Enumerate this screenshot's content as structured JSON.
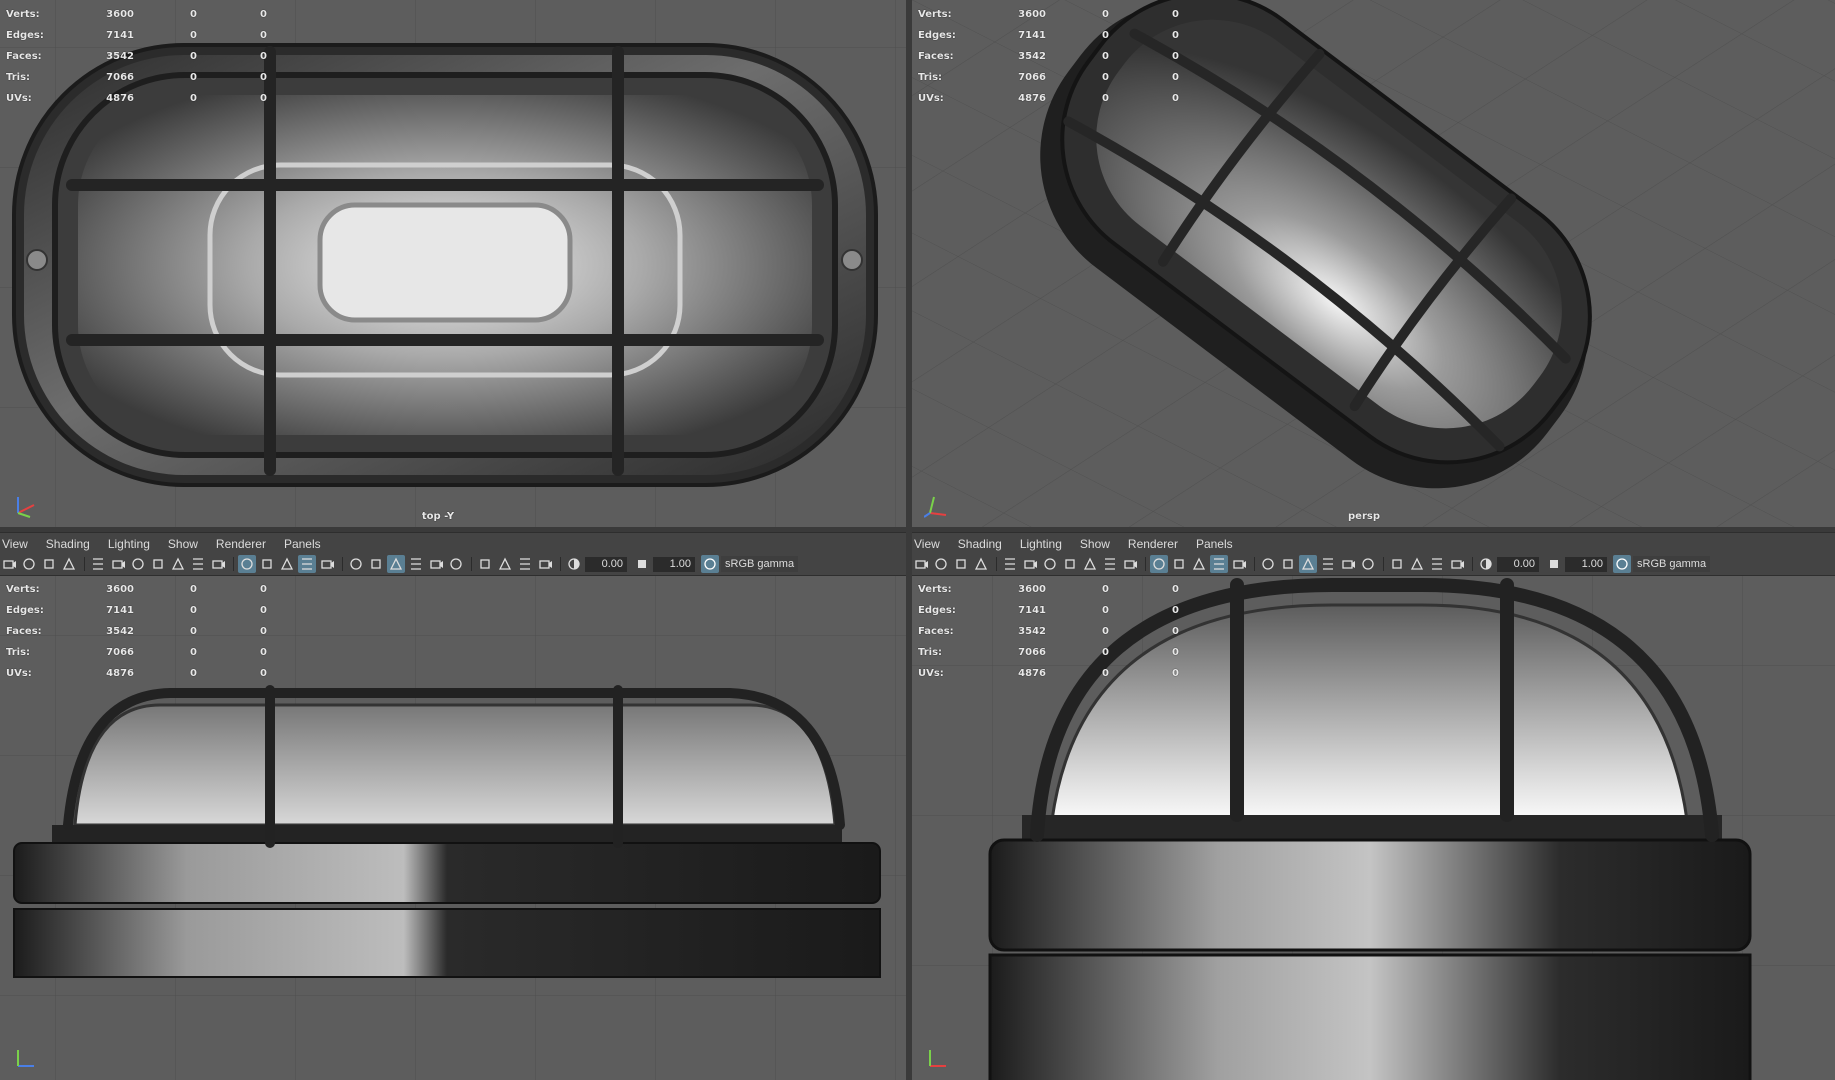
{
  "stats": [
    {
      "label": "Verts:",
      "v1": "3600",
      "v2": "0",
      "v3": "0"
    },
    {
      "label": "Edges:",
      "v1": "7141",
      "v2": "0",
      "v3": "0"
    },
    {
      "label": "Faces:",
      "v1": "3542",
      "v2": "0",
      "v3": "0"
    },
    {
      "label": "Tris:",
      "v1": "7066",
      "v2": "0",
      "v3": "0"
    },
    {
      "label": "UVs:",
      "v1": "4876",
      "v2": "0",
      "v3": "0"
    }
  ],
  "viewports": {
    "top_left": {
      "camera": "top -Y"
    },
    "top_right": {
      "camera": "persp"
    }
  },
  "panel": {
    "menus": [
      "View",
      "Shading",
      "Lighting",
      "Show",
      "Renderer",
      "Panels"
    ],
    "exposure": "0.00",
    "gamma": "1.00",
    "colorspace": "sRGB gamma",
    "icons": [
      "camera-icon",
      "camera-attr-icon",
      "bookmark-icon",
      "image-plane-icon",
      "grid-toggle-icon",
      "film-gate-icon",
      "resolution-gate-icon",
      "gate-mask-icon",
      "field-chart-icon",
      "safe-action-icon",
      "safe-title-icon",
      "wireframe-icon",
      "smooth-shade-icon",
      "default-material-icon",
      "textured-icon",
      "xray-icon",
      "use-lights-icon",
      "shadows-icon",
      "ambient-occlusion-icon",
      "motion-blur-icon",
      "anti-alias-icon",
      "depth-of-field-icon",
      "isolate-select-icon",
      "xray-joints-icon",
      "xray-active-icon",
      "backface-cull-icon"
    ]
  },
  "colors": {
    "viewport_bg": "#5d5d5d",
    "panel_bg": "#444444",
    "accent": "#5a7f93",
    "axis_x": "#e64040",
    "axis_y": "#7ad14a",
    "axis_z": "#4a7fe6"
  }
}
